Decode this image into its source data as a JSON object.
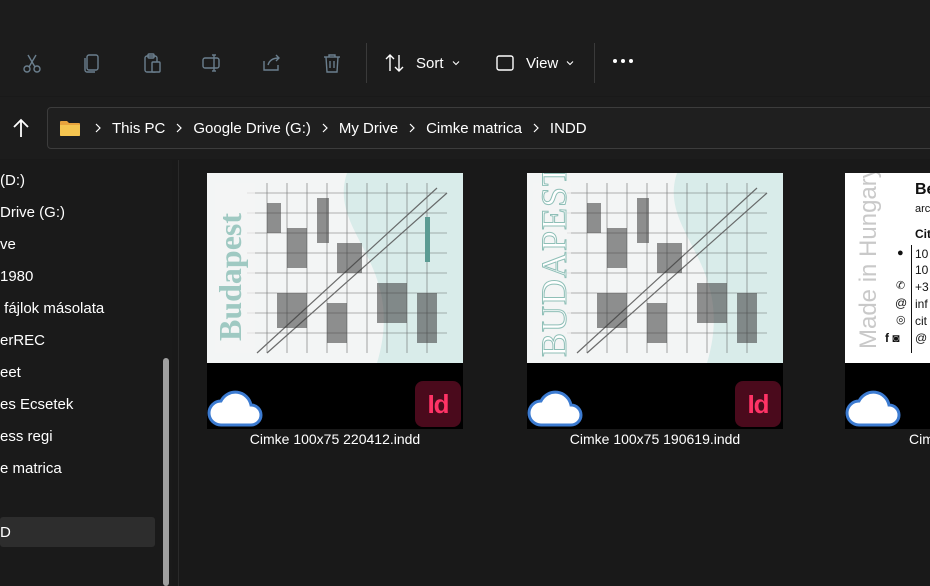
{
  "toolbar": {
    "sort_label": "Sort",
    "view_label": "View"
  },
  "address": {
    "crumbs": [
      "This PC",
      "Google Drive (G:)",
      "My Drive",
      "Cimke matrica",
      "INDD"
    ]
  },
  "sidebar": {
    "items": [
      {
        "label": "(D:)"
      },
      {
        "label": "Drive (G:)"
      },
      {
        "label": "ve"
      },
      {
        "label": "1980"
      },
      {
        "label": " fájlok másolata"
      },
      {
        "label": "erREC"
      },
      {
        "label": "eet"
      },
      {
        "label": "es Ecsetek"
      },
      {
        "label": "ess regi"
      },
      {
        "label": "e matrica"
      },
      {
        "label": "D"
      }
    ]
  },
  "files": [
    {
      "name": "Cimke 100x75 220412.indd",
      "art_text": "Budapest",
      "sync": "cloud-icon",
      "app": "Id"
    },
    {
      "name": "Cimke 100x75 190619.indd",
      "art_text": "BUDAPEST",
      "sync": "cloud-icon",
      "app": "Id"
    },
    {
      "name": "Cim",
      "art_text": "Made in Hungary",
      "sync": "cloud-icon",
      "card_lines": [
        "Be",
        "arc",
        "Cit",
        "10",
        "10",
        "+3",
        "inf",
        "cit",
        "@"
      ]
    }
  ],
  "colors": {
    "background": "#191919",
    "indesign_badge": "#4a0a1c",
    "indesign_text": "#ff3366",
    "cloud_blue": "#3c7bd1",
    "art_teal": "#9fc9c2"
  }
}
